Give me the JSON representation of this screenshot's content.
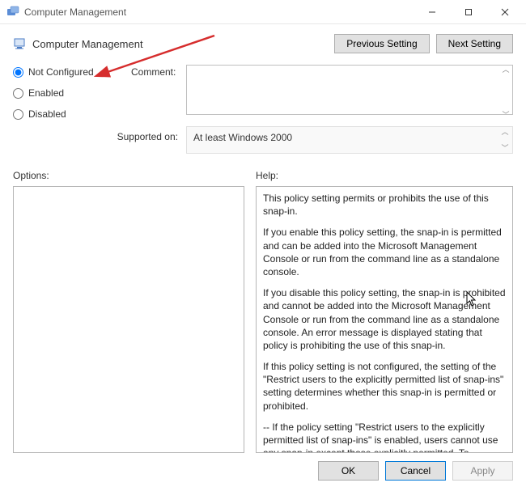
{
  "titlebar": {
    "title": "Computer Management"
  },
  "policy": {
    "title": "Computer Management"
  },
  "nav": {
    "prev": "Previous Setting",
    "next": "Next Setting"
  },
  "state": {
    "options": [
      {
        "label": "Not Configured",
        "value": "not_configured"
      },
      {
        "label": "Enabled",
        "value": "enabled"
      },
      {
        "label": "Disabled",
        "value": "disabled"
      }
    ],
    "selected": "not_configured"
  },
  "labels": {
    "comment": "Comment:",
    "supported_on": "Supported on:",
    "options": "Options:",
    "help": "Help:"
  },
  "comment": {
    "value": ""
  },
  "supported": {
    "value": "At least Windows 2000"
  },
  "help_text": {
    "p1": "This policy setting permits or prohibits the use of this snap-in.",
    "p2": "If you enable this policy setting, the snap-in is permitted and can be added into the Microsoft Management Console or run from the command line as a standalone console.",
    "p3": "If you disable this policy setting, the snap-in is prohibited and cannot be added into the Microsoft Management Console or run from the command line as a standalone console. An error message is displayed stating that policy is prohibiting the use of this snap-in.",
    "p4": "If this policy setting is not configured, the setting of the \"Restrict users to the explicitly permitted list of snap-ins\" setting determines whether this snap-in is permitted or prohibited.",
    "p5": "--  If the policy setting \"Restrict users to the explicitly permitted list of snap-ins\" is enabled, users cannot use any snap-in except those explicitly permitted. To explicitly permit use of this snap-in, enable this policy setting. If this policy setting is not configured or"
  },
  "footer": {
    "ok": "OK",
    "cancel": "Cancel",
    "apply": "Apply"
  }
}
